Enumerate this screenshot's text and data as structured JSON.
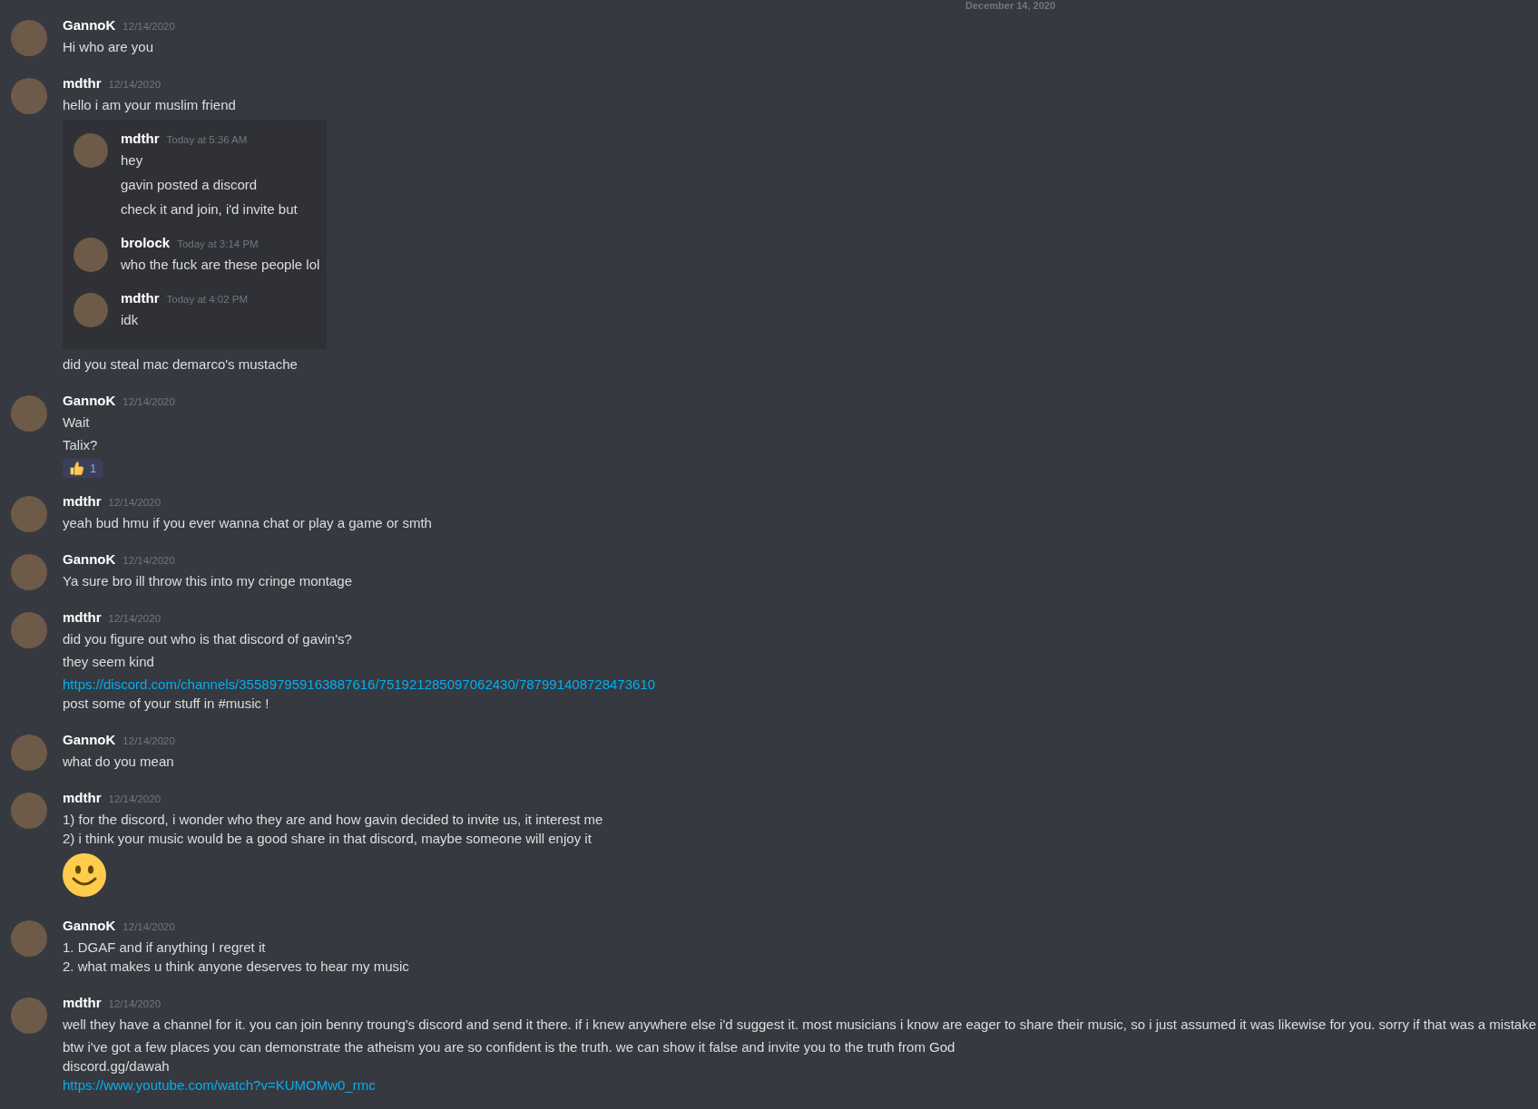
{
  "date_divider": "December 14, 2020",
  "messages": [
    {
      "author": "GannoK",
      "timestamp": "12/14/2020",
      "paragraphs": [
        [
          {
            "kind": "text",
            "text": "Hi who are you"
          }
        ]
      ]
    },
    {
      "author": "mdthr",
      "timestamp": "12/14/2020",
      "paragraphs": [
        [
          {
            "kind": "text",
            "text": "hello i am your muslim friend"
          }
        ]
      ],
      "quote": [
        {
          "author": "mdthr",
          "timestamp": "Today at 5:36 AM",
          "paragraphs": [
            [
              {
                "kind": "text",
                "text": "hey"
              }
            ],
            [
              {
                "kind": "text",
                "text": "gavin posted a discord"
              }
            ],
            [
              {
                "kind": "text",
                "text": "check it and join, i'd invite but"
              }
            ]
          ]
        },
        {
          "author": "brolock",
          "timestamp": "Today at 3:14 PM",
          "paragraphs": [
            [
              {
                "kind": "text",
                "text": "who the fuck are these people lol"
              }
            ]
          ]
        },
        {
          "author": "mdthr",
          "timestamp": "Today at 4:02 PM",
          "paragraphs": [
            [
              {
                "kind": "text",
                "text": "idk"
              }
            ]
          ]
        }
      ],
      "after": [
        [
          {
            "kind": "text",
            "text": "did you steal mac demarco's mustache"
          }
        ]
      ]
    },
    {
      "author": "GannoK",
      "timestamp": "12/14/2020",
      "paragraphs": [
        [
          {
            "kind": "text",
            "text": "Wait"
          }
        ],
        [
          {
            "kind": "text",
            "text": "Talix?"
          }
        ]
      ],
      "reactions": [
        {
          "count": "1",
          "selected": true
        }
      ]
    },
    {
      "author": "mdthr",
      "timestamp": "12/14/2020",
      "paragraphs": [
        [
          {
            "kind": "text",
            "text": "yeah bud hmu if you ever wanna chat or play a game or smth"
          }
        ]
      ]
    },
    {
      "author": "GannoK",
      "timestamp": "12/14/2020",
      "paragraphs": [
        [
          {
            "kind": "text",
            "text": "Ya sure bro ill throw this into my cringe montage"
          }
        ]
      ]
    },
    {
      "author": "mdthr",
      "timestamp": "12/14/2020",
      "paragraphs": [
        [
          {
            "kind": "text",
            "text": "did you figure out who is that discord of gavin's?"
          }
        ],
        [
          {
            "kind": "text",
            "text": "they seem kind"
          }
        ],
        [
          {
            "kind": "link",
            "text": "https://discord.com/channels/355897959163887616/751921285097062430/787991408728473610"
          },
          {
            "kind": "text",
            "text": "post some of your stuff in #music !"
          }
        ]
      ]
    },
    {
      "author": "GannoK",
      "timestamp": "12/14/2020",
      "paragraphs": [
        [
          {
            "kind": "text",
            "text": "what do you mean"
          }
        ]
      ]
    },
    {
      "author": "mdthr",
      "timestamp": "12/14/2020",
      "paragraphs": [
        [
          {
            "kind": "text",
            "text": "1) for the discord, i wonder who they are and how gavin decided to invite us, it interest me"
          },
          {
            "kind": "text",
            "text": "2) i think your music would be a good share in that discord, maybe someone will enjoy it"
          }
        ],
        [
          {
            "kind": "emoji"
          }
        ]
      ]
    },
    {
      "author": "GannoK",
      "timestamp": "12/14/2020",
      "paragraphs": [
        [
          {
            "kind": "text",
            "text": "1. DGAF and if anything I regret it"
          },
          {
            "kind": "text",
            "text": "2. what makes u think anyone deserves to hear my music"
          }
        ]
      ]
    },
    {
      "author": "mdthr",
      "timestamp": "12/14/2020",
      "paragraphs": [
        [
          {
            "kind": "text",
            "text": "well they have a channel for it. you can join benny troung's discord and send it there. if i knew anywhere else i'd suggest it. most musicians i know are eager to share their music, so i just assumed it was likewise for you. sorry if that was a mistake"
          }
        ],
        [
          {
            "kind": "text",
            "text": "btw i've got a few places you can demonstrate the atheism you are so confident is the truth. we can show it false and invite you to the truth from God"
          },
          {
            "kind": "text",
            "text": "discord.gg/dawah"
          },
          {
            "kind": "link",
            "text": "https://www.youtube.com/watch?v=KUMOMw0_rmc"
          }
        ]
      ]
    }
  ]
}
